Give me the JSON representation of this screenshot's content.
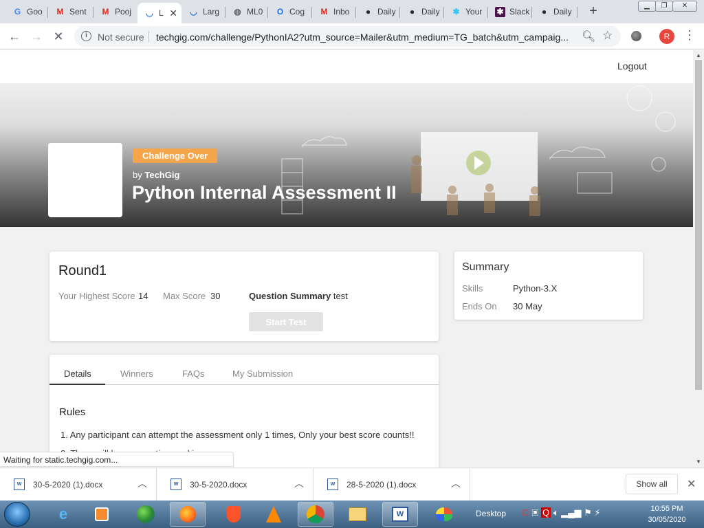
{
  "browser": {
    "tabs": [
      {
        "title": "Goo",
        "icon": "google-icon"
      },
      {
        "title": "Sent",
        "icon": "gmail-icon"
      },
      {
        "title": "Pooj",
        "icon": "gmail-icon"
      },
      {
        "title": "L",
        "icon": "loading-icon",
        "active": true
      },
      {
        "title": "Larg",
        "icon": "loading-icon"
      },
      {
        "title": "ML0",
        "icon": "globe-icon"
      },
      {
        "title": "Cog",
        "icon": "cognizant-icon"
      },
      {
        "title": "Inbo",
        "icon": "gmail-icon"
      },
      {
        "title": "Daily",
        "icon": "github-icon"
      },
      {
        "title": "Daily",
        "icon": "github-icon"
      },
      {
        "title": "Your",
        "icon": "slack-icon"
      },
      {
        "title": "Slack",
        "icon": "slack-icon"
      },
      {
        "title": "Daily",
        "icon": "github-icon"
      }
    ],
    "security_label": "Not secure",
    "url": "techgig.com/challenge/PythonIA2?utm_source=Mailer&utm_medium=TG_batch&utm_campaig...",
    "profile_initial": "R",
    "status_text": "Waiting for static.techgig.com..."
  },
  "page": {
    "logout_label": "Logout",
    "badge": "Challenge Over",
    "by_prefix": "by",
    "organizer": "TechGig",
    "title": "Python Internal Assessment II",
    "round": {
      "title": "Round1",
      "highest_score_label": "Your Highest Score",
      "highest_score": "14",
      "max_score_label": "Max Score",
      "max_score": "30",
      "question_summary_label": "Question Summary",
      "question_summary_value": "test",
      "start_label": "Start Test"
    },
    "summary": {
      "title": "Summary",
      "skills_label": "Skills",
      "skills_value": "Python-3.X",
      "ends_label": "Ends On",
      "ends_value": "30 May"
    },
    "tabs": [
      "Details",
      "Winners",
      "FAQs",
      "My Submission"
    ],
    "rules_heading": "Rules",
    "rules": [
      "1.   Any participant can attempt the assessment only 1 times, Only your best score counts!!",
      "2.   There will be no negative marking."
    ]
  },
  "downloads": {
    "files": [
      "30-5-2020 (1).docx",
      "30-5-2020.docx",
      "28-5-2020 (1).docx"
    ],
    "show_all_label": "Show all"
  },
  "taskbar": {
    "desktop_label": "Desktop",
    "time": "10:55 PM",
    "date": "30/05/2020"
  },
  "colors": {
    "badge": "#f5a54a",
    "avatar": "#e8453c"
  }
}
